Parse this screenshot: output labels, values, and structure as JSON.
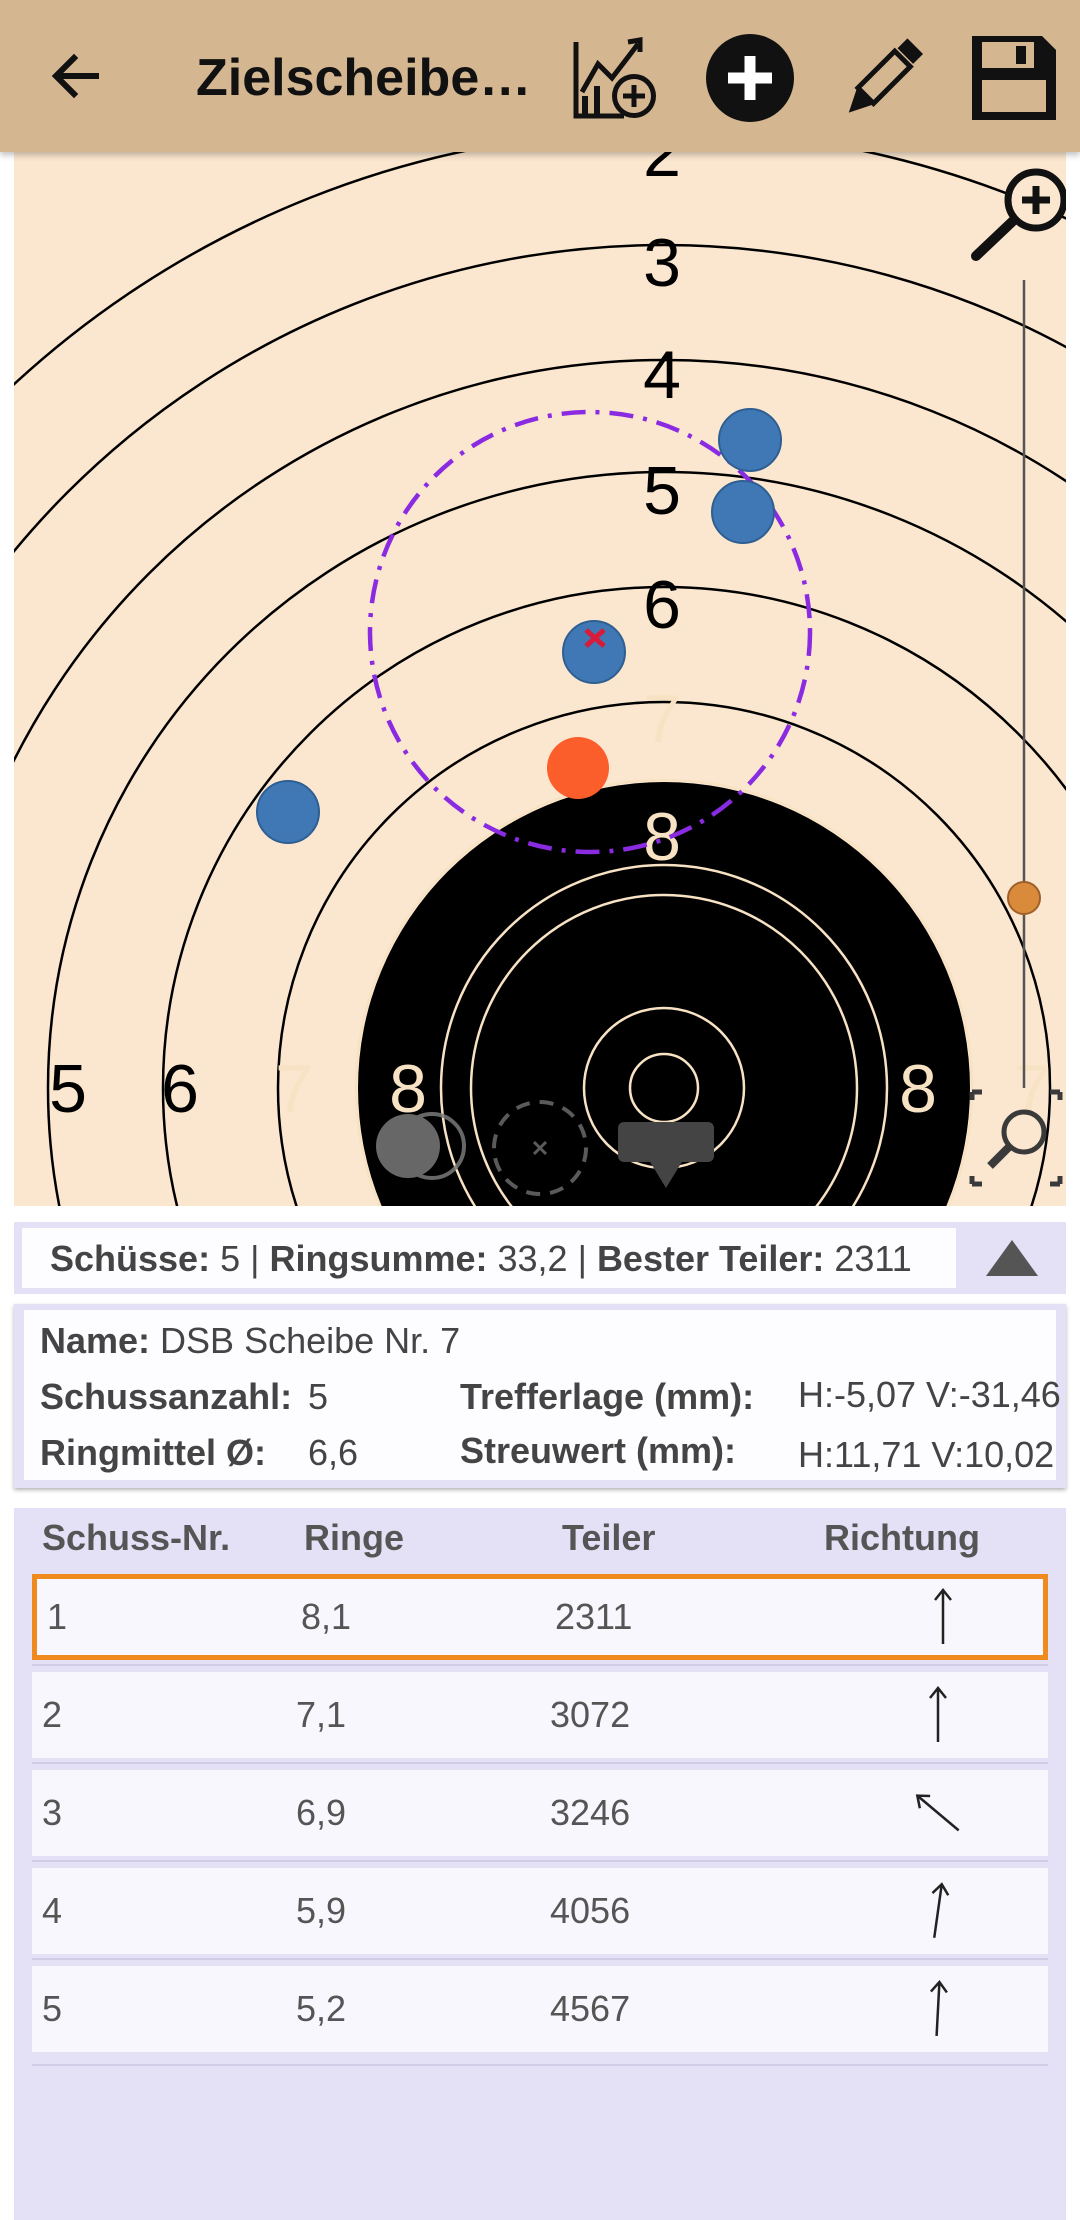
{
  "app_bar": {
    "title": "Zielscheibe…",
    "back_icon": "arrow-left-icon",
    "actions": [
      "chart-add-icon",
      "add-circle-icon",
      "pencil-icon",
      "save-icon"
    ]
  },
  "target": {
    "ring_numbers_top": [
      "2",
      "3",
      "4",
      "5",
      "6",
      "7",
      "8"
    ],
    "ring_numbers_left": [
      "5",
      "6",
      "7",
      "8"
    ],
    "ring_numbers_right": [
      "8",
      "7"
    ],
    "colors": {
      "paper": "#fbe7cf",
      "black_zone": "#000000",
      "shot": "#3f78b4",
      "selected_shot": "#fb5e2b",
      "group_circle": "#8a2be2",
      "center_mark": "#d81b3a",
      "zoom_slider": "#d98a3a"
    },
    "zoom_icon": "zoom-in-icon",
    "toggle_icons": [
      "layers-toggle-icon",
      "center-mark-icon",
      "filter-dropdown-icon",
      "fit-zoom-icon"
    ]
  },
  "summary": {
    "shots_label": "Schüsse:",
    "shots_value": " 5",
    "ringsum_label": "Ringsumme:",
    "ringsum_value": " 33,2",
    "best_label": "Bester Teiler:",
    "best_value": " 2311",
    "separator": " | ",
    "collapse_icon": "triangle-up-icon"
  },
  "details": {
    "name_label": "Name:",
    "name_value": " DSB Scheibe Nr. 7",
    "count_label": "Schussanzahl:",
    "count_value": "5",
    "avg_label": "Ringmittel Ø:",
    "avg_value": "6,6",
    "pos_label": "Trefferlage (mm):",
    "pos_value": "H:-5,07 V:-31,46",
    "spread_label": "Streuwert (mm):",
    "spread_value": "H:11,71 V:10,02"
  },
  "table": {
    "headers": [
      "Schuss-Nr.",
      "Ringe",
      "Teiler",
      "Richtung"
    ],
    "rows": [
      {
        "nr": "1",
        "ringe": "8,1",
        "teiler": "2311",
        "direction_deg": 0
      },
      {
        "nr": "2",
        "ringe": "7,1",
        "teiler": "3072",
        "direction_deg": 0
      },
      {
        "nr": "3",
        "ringe": "6,9",
        "teiler": "3246",
        "direction_deg": -50
      },
      {
        "nr": "4",
        "ringe": "5,9",
        "teiler": "4056",
        "direction_deg": 8
      },
      {
        "nr": "5",
        "ringe": "5,2",
        "teiler": "4567",
        "direction_deg": 3
      }
    ],
    "selected_row": 0,
    "direction_icon": "arrow-direction-icon"
  }
}
